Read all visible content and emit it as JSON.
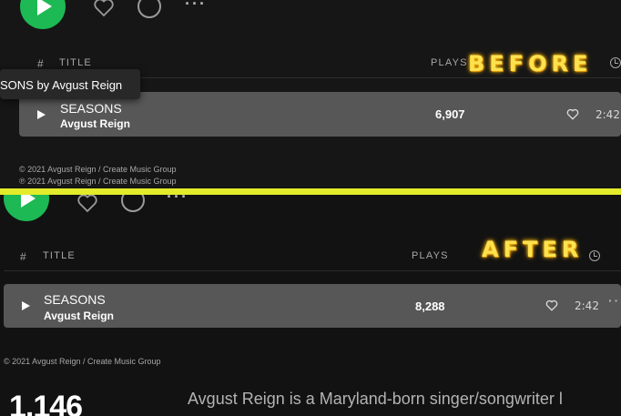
{
  "before": {
    "label": "BEFORE",
    "header": {
      "hash": "#",
      "title": "TITLE",
      "plays": "PLAYS"
    },
    "tooltip": "SONS by Avgust Reign",
    "track": {
      "title": "SEASONS",
      "artist": "Avgust Reign",
      "plays": "6,907",
      "duration": "2:42"
    },
    "copyright_c": "© 2021 Avgust Reign / Create Music Group",
    "copyright_p": "℗ 2021 Avgust Reign / Create Music Group"
  },
  "after": {
    "label": "AFTER",
    "header": {
      "hash": "#",
      "title": "TITLE",
      "plays": "PLAYS"
    },
    "track": {
      "title": "SEASONS",
      "artist": "Avgust Reign",
      "plays": "8,288",
      "duration": "2:42"
    },
    "copyright_c": "© 2021 Avgust Reign / Create Music Group",
    "about": {
      "count": "1,146",
      "bio": "Avgust Reign is a Maryland-born singer/songwriter l"
    }
  },
  "colors": {
    "accent_green": "#1db954",
    "divider": "#e2ec2a",
    "label_glow": "#f7b20b",
    "label_text": "#fde24f"
  },
  "icons": [
    "play-icon",
    "heart-icon",
    "download-icon",
    "more-icon",
    "clock-icon"
  ]
}
